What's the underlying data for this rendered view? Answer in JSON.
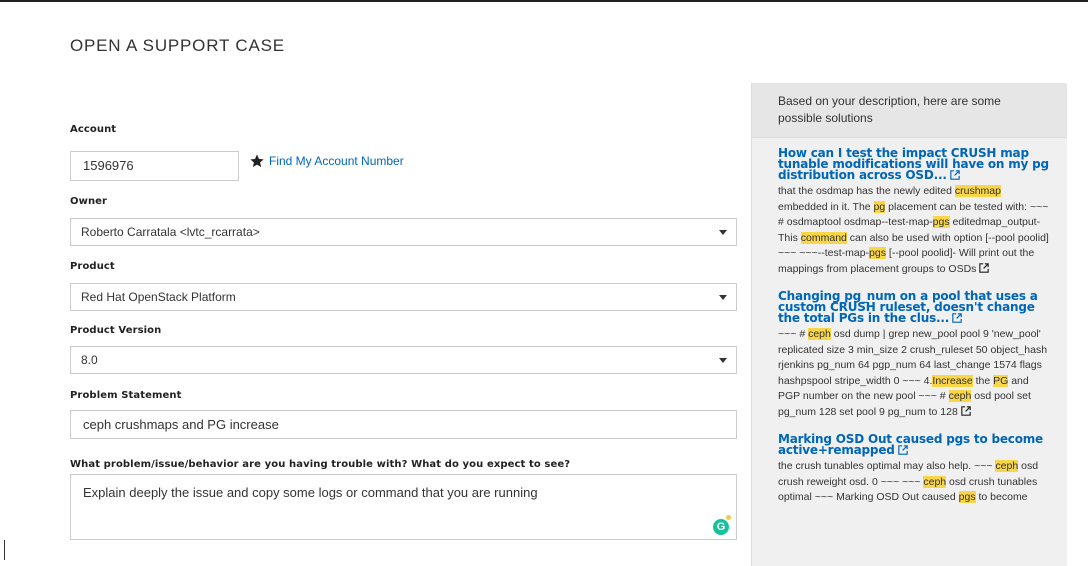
{
  "page": {
    "title": "OPEN A SUPPORT CASE"
  },
  "form": {
    "account": {
      "label": "Account",
      "value": "1596976",
      "find_link": "Find My Account Number"
    },
    "owner": {
      "label": "Owner",
      "value": "Roberto Carratala <lvtc_rcarrata>"
    },
    "product": {
      "label": "Product",
      "value": "Red Hat OpenStack Platform"
    },
    "product_version": {
      "label": "Product Version",
      "value": "8.0"
    },
    "problem_statement": {
      "label": "Problem Statement",
      "value": "ceph crushmaps and PG increase"
    },
    "description": {
      "label": "What problem/issue/behavior are you having trouble with?  What do you expect to see?",
      "value": "Explain deeply the issue and copy some logs or command that you are running"
    }
  },
  "icons": {
    "star": "star-icon",
    "external": "external-link-icon",
    "grammarly": "grammarly-icon",
    "caret": "chevron-down-icon"
  },
  "colors": {
    "link": "#0066b8",
    "highlight": "#f9d648",
    "panel": "#f0f0f0"
  },
  "solutions": {
    "heading": "Based on your description, here are some possible solutions",
    "items": [
      {
        "title": "How can I test the impact CRUSH map tunable modifications will have on my pg distribution across OSD...",
        "segments": [
          {
            "t": "that the osdmap has the newly edited "
          },
          {
            "t": "crushmap",
            "hl": true
          },
          {
            "t": " embedded in it. The "
          },
          {
            "t": "pg",
            "hl": true
          },
          {
            "t": " placement can be tested with: ~~~ # osdmaptool osdmap--test-map-"
          },
          {
            "t": "pgs",
            "hl": true
          },
          {
            "t": " editedmap_output- This "
          },
          {
            "t": "command",
            "hl": true
          },
          {
            "t": " can also be used with option [--pool poolid] ~~~ ~~~--test-map-"
          },
          {
            "t": "pgs",
            "hl": true
          },
          {
            "t": " [--pool poolid]- Will print out the mappings from placement groups to OSDs"
          }
        ]
      },
      {
        "title": "Changing pg_num on a pool that uses a custom CRUSH ruleset, doesn't change the total PGs in the clus...",
        "segments": [
          {
            "t": "~~~ # "
          },
          {
            "t": "ceph",
            "hl": true
          },
          {
            "t": " osd dump | grep new_pool pool 9 'new_pool' replicated size 3 min_size 2 crush_ruleset 50 object_hash rjenkins pg_num 64 pgp_num 64 last_change 1574 flags hashpspool stripe_width 0 ~~~ 4."
          },
          {
            "t": "Increase",
            "hl": true
          },
          {
            "t": " the "
          },
          {
            "t": "PG",
            "hl": true
          },
          {
            "t": " and PGP number on the new pool ~~~ # "
          },
          {
            "t": "ceph",
            "hl": true
          },
          {
            "t": " osd pool set pg_num 128 set pool 9 pg_num to 128"
          }
        ]
      },
      {
        "title": "Marking OSD Out caused pgs to become active+remapped",
        "segments": [
          {
            "t": "the crush tunables optimal may also help. ~~~ "
          },
          {
            "t": "ceph",
            "hl": true
          },
          {
            "t": " osd crush reweight osd. 0 ~~~ ~~~ "
          },
          {
            "t": "ceph",
            "hl": true
          },
          {
            "t": " osd crush tunables optimal ~~~ Marking OSD Out caused "
          },
          {
            "t": "pgs",
            "hl": true
          },
          {
            "t": " to become"
          }
        ]
      }
    ]
  }
}
